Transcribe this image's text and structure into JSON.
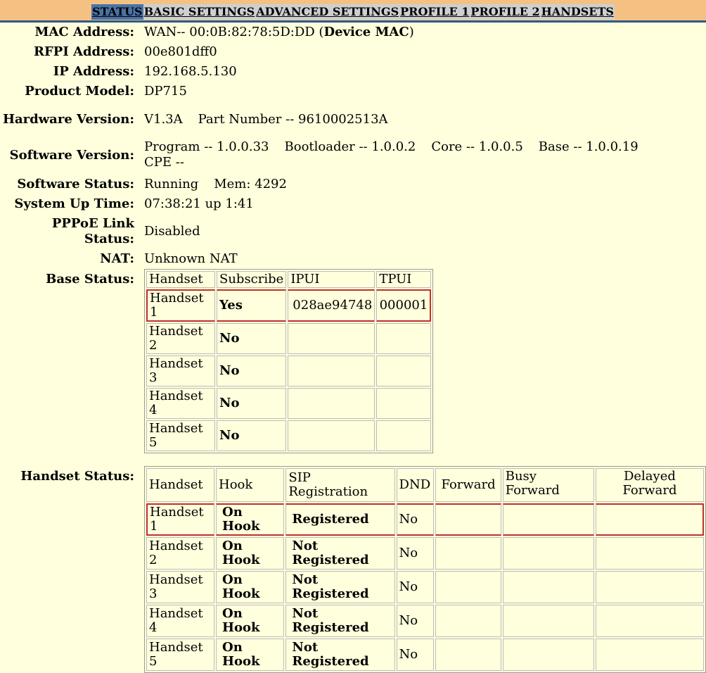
{
  "nav": [
    {
      "label": "STATUS",
      "active": true
    },
    {
      "label": "BASIC SETTINGS",
      "active": false
    },
    {
      "label": "ADVANCED SETTINGS",
      "active": false
    },
    {
      "label": "PROFILE 1",
      "active": false
    },
    {
      "label": "PROFILE 2",
      "active": false
    },
    {
      "label": "HANDSETS",
      "active": false
    }
  ],
  "info": {
    "mac_label": "MAC Address:",
    "mac_prefix": "WAN-- 00:0B:82:78:5D:DD (",
    "mac_bold": "Device MAC",
    "mac_suffix": ")",
    "rfpi_label": "RFPI Address:",
    "rfpi_value": "00e801dff0",
    "ip_label": "IP Address:",
    "ip_value": "192.168.5.130",
    "model_label": "Product Model:",
    "model_value": "DP715",
    "hw_label": "Hardware Version:",
    "hw_version": "V1.3A",
    "hw_part": "Part Number -- 9610002513A",
    "sw_label": "Software Version:",
    "sw_program": "Program -- 1.0.0.33",
    "sw_boot": "Bootloader -- 1.0.0.2",
    "sw_core": "Core -- 1.0.0.5",
    "sw_base": "Base -- 1.0.0.19",
    "sw_cpe": "CPE --",
    "status_label": "Software Status:",
    "status_running": "Running",
    "status_mem": "Mem: 4292",
    "uptime_label": "System Up Time:",
    "uptime_value": "07:38:21 up 1:41",
    "pppoe_label": "PPPoE Link Status:",
    "pppoe_value": "Disabled",
    "nat_label": "NAT:",
    "nat_value": "Unknown NAT",
    "base_label": "Base Status:",
    "handset_label": "Handset Status:"
  },
  "base_status": {
    "headers": [
      "Handset",
      "Subscribe",
      "IPUI",
      "TPUI"
    ],
    "rows": [
      [
        "Handset 1",
        "Yes",
        "028ae94748",
        "000001"
      ],
      [
        "Handset 2",
        "No",
        "",
        ""
      ],
      [
        "Handset 3",
        "No",
        "",
        ""
      ],
      [
        "Handset 4",
        "No",
        "",
        ""
      ],
      [
        "Handset 5",
        "No",
        "",
        ""
      ]
    ]
  },
  "handset_status": {
    "headers": [
      "Handset",
      "Hook",
      "SIP Registration",
      "DND",
      "Forward",
      "Busy Forward",
      "Delayed Forward"
    ],
    "rows": [
      [
        "Handset 1",
        "On Hook",
        "Registered",
        "No",
        "",
        "",
        ""
      ],
      [
        "Handset 2",
        "On Hook",
        "Not Registered",
        "No",
        "",
        "",
        ""
      ],
      [
        "Handset 3",
        "On Hook",
        "Not Registered",
        "No",
        "",
        "",
        ""
      ],
      [
        "Handset 4",
        "On Hook",
        "Not Registered",
        "No",
        "",
        "",
        ""
      ],
      [
        "Handset 5",
        "On Hook",
        "Not Registered",
        "No",
        "",
        "",
        ""
      ]
    ]
  },
  "colors": {
    "header_bg": "#f5c183",
    "body_bg": "#ffffdd",
    "nav_active": "#4a73a6",
    "highlight": "#c0302c"
  }
}
